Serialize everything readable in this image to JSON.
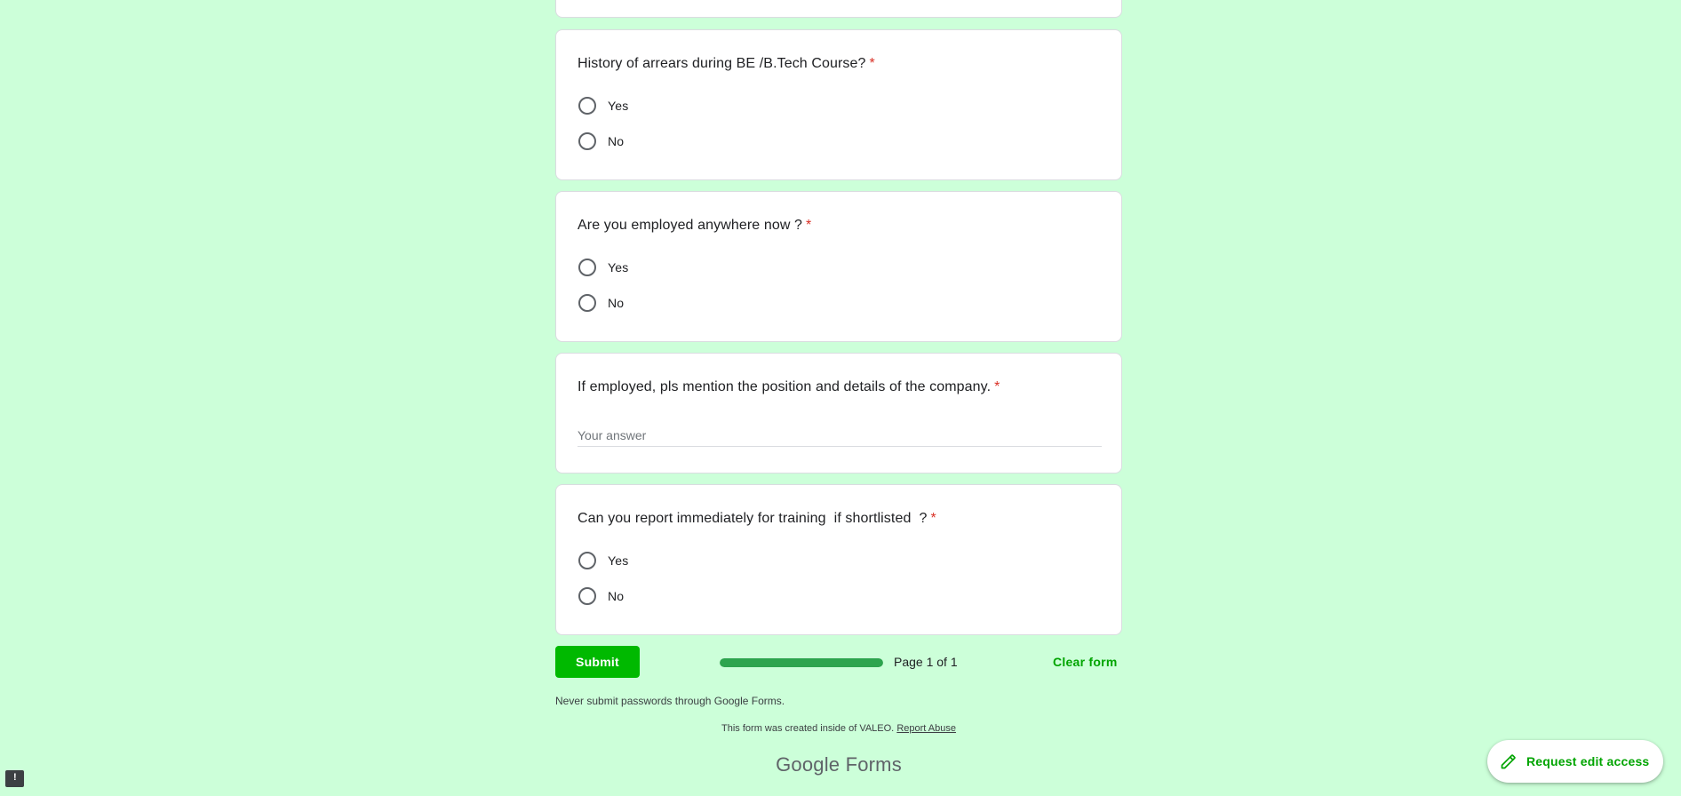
{
  "questions": [
    {
      "title": "History of arrears during BE /B.Tech Course?",
      "required_mark": "*",
      "options": [
        "Yes",
        "No"
      ]
    },
    {
      "title": "Are you employed anywhere now ?",
      "required_mark": "*",
      "options": [
        "Yes",
        "No"
      ]
    },
    {
      "title": "If employed, pls mention the position and details of the company.",
      "required_mark": "*",
      "answer_placeholder": "Your answer",
      "answer_value": ""
    },
    {
      "title": "Can you report immediately for training  if shortlisted  ?",
      "required_mark": "*",
      "options": [
        "Yes",
        "No"
      ]
    }
  ],
  "actions": {
    "submit_label": "Submit",
    "clear_label": "Clear form"
  },
  "progress": {
    "page_text": "Page 1 of 1",
    "fraction_complete": 1.0
  },
  "footer": {
    "never_submit": "Never submit passwords through Google Forms.",
    "created_inside": "This form was created inside of VALEO.",
    "report_abuse": "Report Abuse",
    "brand_google": "Google",
    "brand_forms": "Forms"
  },
  "fab": {
    "label": "Request edit access",
    "icon": "pencil-icon"
  },
  "feedback": {
    "icon": "feedback-icon",
    "glyph": "!"
  },
  "colors": {
    "background": "#ccffd9",
    "accent": "#00b900",
    "accent_text": "#00a400",
    "required": "#d93025",
    "progress": "#2da44e"
  }
}
